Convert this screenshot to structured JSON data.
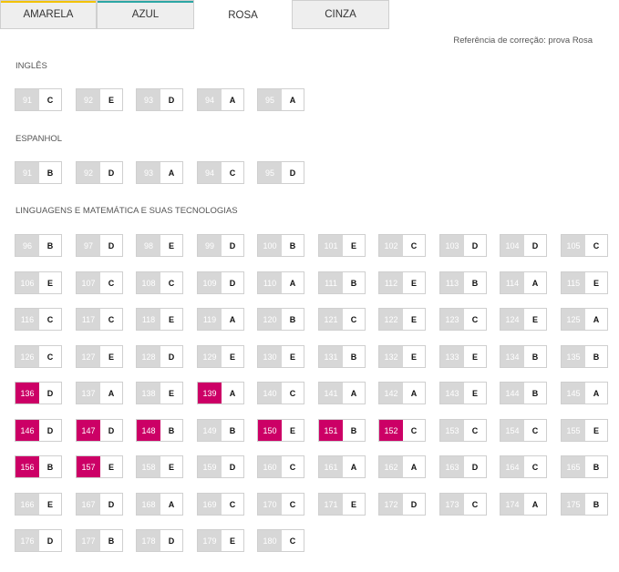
{
  "tabs": [
    {
      "label": "AMARELA",
      "active": false,
      "accent": "#f2c200"
    },
    {
      "label": "AZUL",
      "active": false,
      "accent": "#2ca6a4"
    },
    {
      "label": "ROSA",
      "active": true,
      "accent": ""
    },
    {
      "label": "CINZA",
      "active": false,
      "accent": ""
    }
  ],
  "reference": "Referência de correção: prova Rosa",
  "colors": {
    "highlight": "#cc0066",
    "number_bg": "#d7d7d7",
    "border": "#cfcfcf"
  },
  "sections": [
    {
      "title": "INGLÊS",
      "items": [
        {
          "n": "91",
          "a": "C"
        },
        {
          "n": "92",
          "a": "E"
        },
        {
          "n": "93",
          "a": "D"
        },
        {
          "n": "94",
          "a": "A"
        },
        {
          "n": "95",
          "a": "A"
        }
      ]
    },
    {
      "title": "ESPANHOL",
      "items": [
        {
          "n": "91",
          "a": "B"
        },
        {
          "n": "92",
          "a": "D"
        },
        {
          "n": "93",
          "a": "A"
        },
        {
          "n": "94",
          "a": "C"
        },
        {
          "n": "95",
          "a": "D"
        }
      ]
    },
    {
      "title": "LINGUAGENS E MATEMÁTICA E SUAS TECNOLOGIAS",
      "items": [
        {
          "n": "96",
          "a": "B"
        },
        {
          "n": "97",
          "a": "D"
        },
        {
          "n": "98",
          "a": "E"
        },
        {
          "n": "99",
          "a": "D"
        },
        {
          "n": "100",
          "a": "B"
        },
        {
          "n": "101",
          "a": "E"
        },
        {
          "n": "102",
          "a": "C"
        },
        {
          "n": "103",
          "a": "D"
        },
        {
          "n": "104",
          "a": "D"
        },
        {
          "n": "105",
          "a": "C"
        },
        {
          "n": "106",
          "a": "E"
        },
        {
          "n": "107",
          "a": "C"
        },
        {
          "n": "108",
          "a": "C"
        },
        {
          "n": "109",
          "a": "D"
        },
        {
          "n": "110",
          "a": "A"
        },
        {
          "n": "111",
          "a": "B"
        },
        {
          "n": "112",
          "a": "E"
        },
        {
          "n": "113",
          "a": "B"
        },
        {
          "n": "114",
          "a": "A"
        },
        {
          "n": "115",
          "a": "E"
        },
        {
          "n": "116",
          "a": "C"
        },
        {
          "n": "117",
          "a": "C"
        },
        {
          "n": "118",
          "a": "E"
        },
        {
          "n": "119",
          "a": "A"
        },
        {
          "n": "120",
          "a": "B"
        },
        {
          "n": "121",
          "a": "C"
        },
        {
          "n": "122",
          "a": "E"
        },
        {
          "n": "123",
          "a": "C"
        },
        {
          "n": "124",
          "a": "E"
        },
        {
          "n": "125",
          "a": "A"
        },
        {
          "n": "126",
          "a": "C"
        },
        {
          "n": "127",
          "a": "E"
        },
        {
          "n": "128",
          "a": "D"
        },
        {
          "n": "129",
          "a": "E"
        },
        {
          "n": "130",
          "a": "E"
        },
        {
          "n": "131",
          "a": "B"
        },
        {
          "n": "132",
          "a": "E"
        },
        {
          "n": "133",
          "a": "E"
        },
        {
          "n": "134",
          "a": "B"
        },
        {
          "n": "135",
          "a": "B"
        },
        {
          "n": "136",
          "a": "D",
          "hl": true
        },
        {
          "n": "137",
          "a": "A"
        },
        {
          "n": "138",
          "a": "E"
        },
        {
          "n": "139",
          "a": "A",
          "hl": true
        },
        {
          "n": "140",
          "a": "C"
        },
        {
          "n": "141",
          "a": "A"
        },
        {
          "n": "142",
          "a": "A"
        },
        {
          "n": "143",
          "a": "E"
        },
        {
          "n": "144",
          "a": "B"
        },
        {
          "n": "145",
          "a": "A"
        },
        {
          "n": "146",
          "a": "D",
          "hl": true
        },
        {
          "n": "147",
          "a": "D",
          "hl": true
        },
        {
          "n": "148",
          "a": "B",
          "hl": true
        },
        {
          "n": "149",
          "a": "B"
        },
        {
          "n": "150",
          "a": "E",
          "hl": true
        },
        {
          "n": "151",
          "a": "B",
          "hl": true
        },
        {
          "n": "152",
          "a": "C",
          "hl": true
        },
        {
          "n": "153",
          "a": "C"
        },
        {
          "n": "154",
          "a": "C"
        },
        {
          "n": "155",
          "a": "E"
        },
        {
          "n": "156",
          "a": "B",
          "hl": true
        },
        {
          "n": "157",
          "a": "E",
          "hl": true
        },
        {
          "n": "158",
          "a": "E"
        },
        {
          "n": "159",
          "a": "D"
        },
        {
          "n": "160",
          "a": "C"
        },
        {
          "n": "161",
          "a": "A"
        },
        {
          "n": "162",
          "a": "A"
        },
        {
          "n": "163",
          "a": "D"
        },
        {
          "n": "164",
          "a": "C"
        },
        {
          "n": "165",
          "a": "B"
        },
        {
          "n": "166",
          "a": "E"
        },
        {
          "n": "167",
          "a": "D"
        },
        {
          "n": "168",
          "a": "A"
        },
        {
          "n": "169",
          "a": "C"
        },
        {
          "n": "170",
          "a": "C"
        },
        {
          "n": "171",
          "a": "E"
        },
        {
          "n": "172",
          "a": "D"
        },
        {
          "n": "173",
          "a": "C"
        },
        {
          "n": "174",
          "a": "A"
        },
        {
          "n": "175",
          "a": "B"
        },
        {
          "n": "176",
          "a": "D"
        },
        {
          "n": "177",
          "a": "B"
        },
        {
          "n": "178",
          "a": "D"
        },
        {
          "n": "179",
          "a": "E"
        },
        {
          "n": "180",
          "a": "C"
        }
      ]
    }
  ]
}
